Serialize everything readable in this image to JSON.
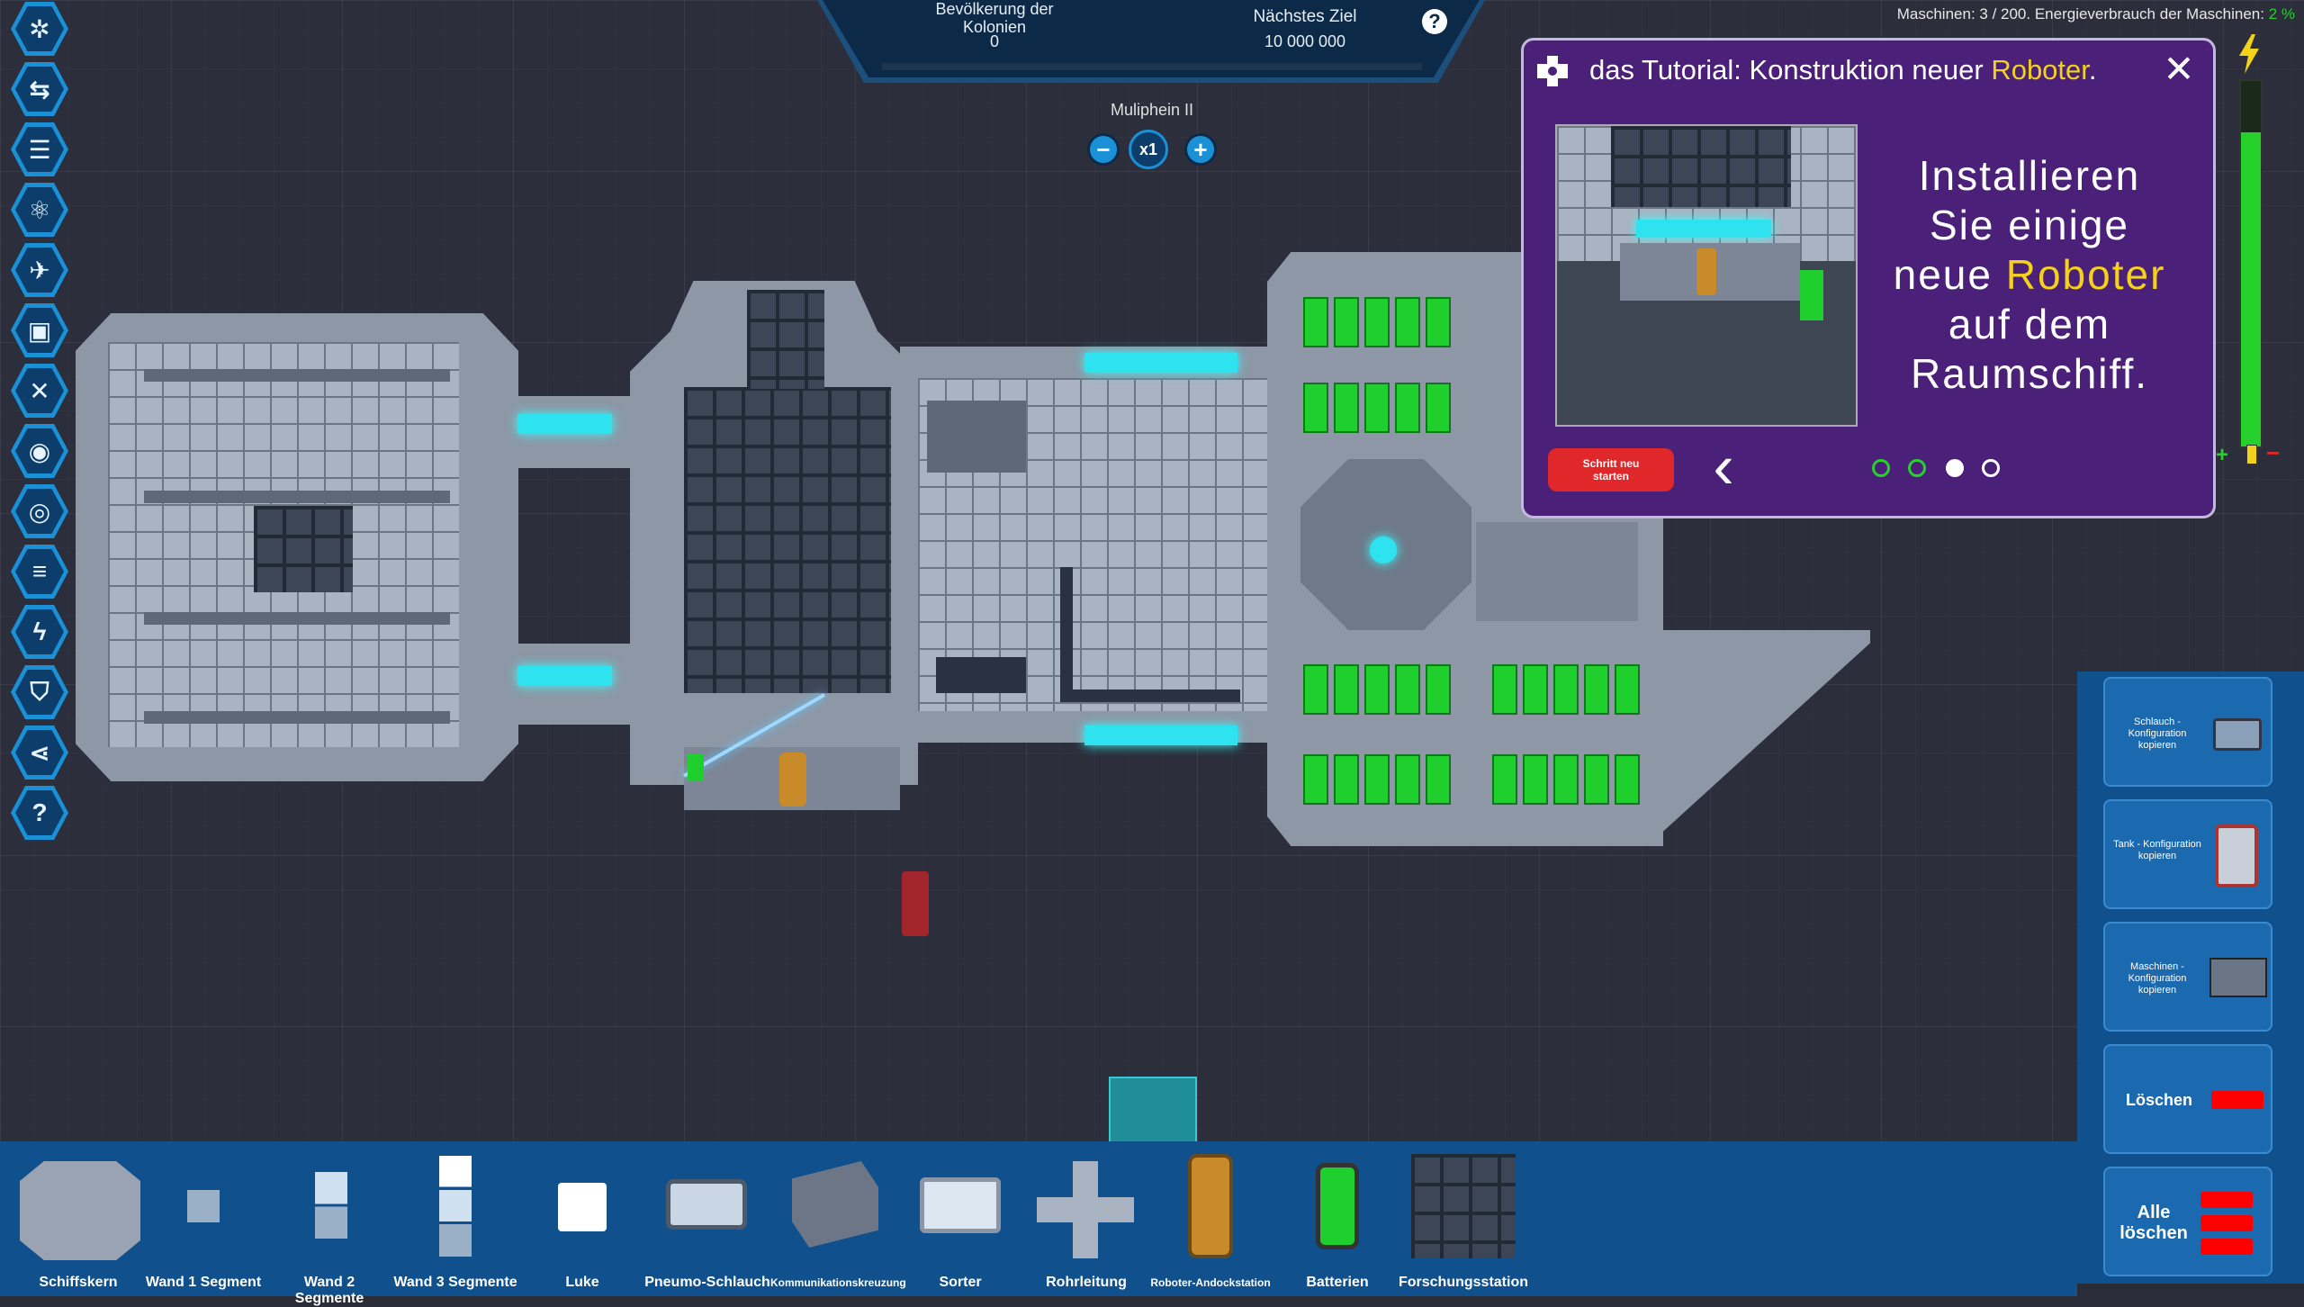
{
  "hud": {
    "population_label": "Bevölkerung der Kolonien",
    "population_value": "0",
    "next_goal_label": "Nächstes Ziel",
    "next_goal_value": "10 000 000",
    "help_glyph": "?",
    "machines_label": "Maschinen: 3 / 200. Energieverbrauch der Maschinen:",
    "energy_percent": "2 %",
    "energy_level": 0.86,
    "ship_name": "Muliphein II",
    "speed_minus": "−",
    "speed_value": "x1",
    "speed_plus": "+"
  },
  "left_toolbar": {
    "icons": [
      "ship-core-icon",
      "connections-icon",
      "list-icon",
      "research-atom-icon",
      "drone-icon",
      "blueprint-icon",
      "tools-icon",
      "view-eye-icon",
      "scan-icon",
      "storage-icon",
      "energy-icon",
      "shield-icon",
      "share-icon",
      "help-icon"
    ],
    "help_glyph": "?"
  },
  "tutorial": {
    "title_prefix": "das Tutorial: Konstruktion neuer ",
    "title_highlight": "Roboter",
    "title_suffix": ".",
    "body_line1": "Installieren",
    "body_line2": "Sie einige",
    "body_line3_prefix": "neue ",
    "body_line3_highlight": "Roboter",
    "body_line4": "auf dem",
    "body_line5": "Raumschiff.",
    "restart_label": "Schritt neu starten",
    "close_glyph": "✕",
    "back_glyph": "‹",
    "steps_total": 4,
    "step_current": 3
  },
  "right_panel": [
    {
      "label": "Schlauch - Konfiguration kopieren"
    },
    {
      "label": "Tank - Konfiguration kopieren"
    },
    {
      "label": "Maschinen - Konfiguration kopieren"
    },
    {
      "label": "Löschen"
    },
    {
      "label": "Alle löschen"
    }
  ],
  "bottom_toolbar": [
    {
      "label": "Schiffskern"
    },
    {
      "label": "Wand 1 Segment"
    },
    {
      "label": "Wand 2 Segmente"
    },
    {
      "label": "Wand 3 Segmente"
    },
    {
      "label": "Luke"
    },
    {
      "label": "Pneumo-Schlauch"
    },
    {
      "label": "Kommunikationskreuzung"
    },
    {
      "label": "Sorter"
    },
    {
      "label": "Rohrleitung"
    },
    {
      "label": "Roboter-Andockstation"
    },
    {
      "label": "Batterien"
    },
    {
      "label": "Forschungsstation"
    }
  ],
  "colors": {
    "accent": "#1a90d6",
    "highlight": "#f3d219",
    "energy": "#27d12b",
    "tutorial_bg": "#4a2079",
    "panel_blue": "#10508c"
  }
}
